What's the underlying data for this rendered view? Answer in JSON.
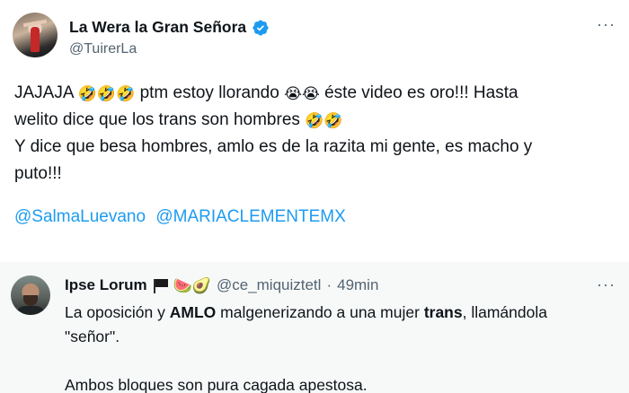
{
  "main_tweet": {
    "display_name": "La Wera la Gran Señora",
    "handle": "@TuirerLa",
    "verified_color": "#1d9bf0",
    "more_label": "···",
    "line1_a": "JAJAJA",
    "line1_emojis": "🤣🤣🤣",
    "line1_b": "ptm estoy llorando",
    "line1_emojis2": "😭😭",
    "line1_c": "éste video es oro!!! Hasta",
    "line2_a": "welito dice que los trans son hombres",
    "line2_emojis": "🤣🤣",
    "line3": "Y dice que besa hombres, amlo es de la razita mi gente, es macho y",
    "line4": "puto!!!",
    "mention1": "@SalmaLuevano",
    "mention2": "@MARIACLEMENTEMX"
  },
  "reply_tweet": {
    "display_name": "Ipse Lorum",
    "name_emojis": "🍉🥑",
    "handle": "@ce_miquiztetl",
    "separator": "·",
    "time": "49min",
    "more_label": "···",
    "line1_a": "La oposición y ",
    "line1_bold1": "AMLO",
    "line1_b": " malgenerizando a una mujer ",
    "line1_bold2": "trans",
    "line1_c": ", llamándola",
    "line2": "\"señor\".",
    "line3": "Ambos bloques son pura cagada apestosa."
  },
  "colors": {
    "link": "#1d9bf0",
    "secondary_text": "#536471",
    "reply_background": "#f7f9f9"
  }
}
